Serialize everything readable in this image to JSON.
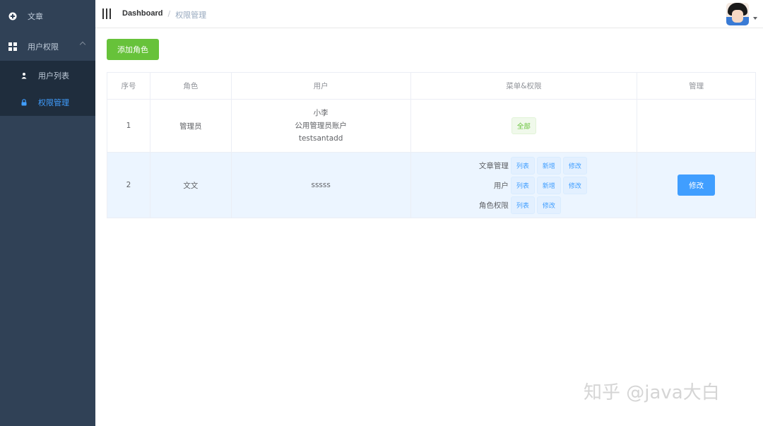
{
  "sidebar": {
    "items": [
      {
        "label": "文章",
        "icon": "plus-circle-icon"
      },
      {
        "label": "用户权限",
        "icon": "grid-icon",
        "expanded": true,
        "children": [
          {
            "label": "用户列表",
            "icon": "user-icon",
            "active": false
          },
          {
            "label": "权限管理",
            "icon": "lock-icon",
            "active": true
          }
        ]
      }
    ]
  },
  "header": {
    "breadcrumb": {
      "first": "Dashboard",
      "separator": "/",
      "current": "权限管理"
    }
  },
  "main": {
    "add_button": "添加角色",
    "table": {
      "columns": [
        "序号",
        "角色",
        "用户",
        "菜单&权限",
        "管理"
      ],
      "rows": [
        {
          "index": "1",
          "role": "管理员",
          "users": [
            "小李",
            "公用管理员账户",
            "testsantadd"
          ],
          "permission_all": "全部"
        },
        {
          "index": "2",
          "role": "文文",
          "users": [
            "sssss"
          ],
          "permissions": [
            {
              "name": "文章管理",
              "actions": [
                "列表",
                "新增",
                "修改"
              ]
            },
            {
              "name": "用户",
              "actions": [
                "列表",
                "新增",
                "修改"
              ]
            },
            {
              "name": "角色权限",
              "actions": [
                "列表",
                "修改"
              ]
            }
          ],
          "action_button": "修改"
        }
      ]
    }
  },
  "watermark": "知乎 @java大白",
  "colors": {
    "sidebar_bg": "#304156",
    "submenu_bg": "#1f2d3d",
    "active": "#409eff",
    "success": "#67c23a",
    "primary": "#409eff"
  }
}
